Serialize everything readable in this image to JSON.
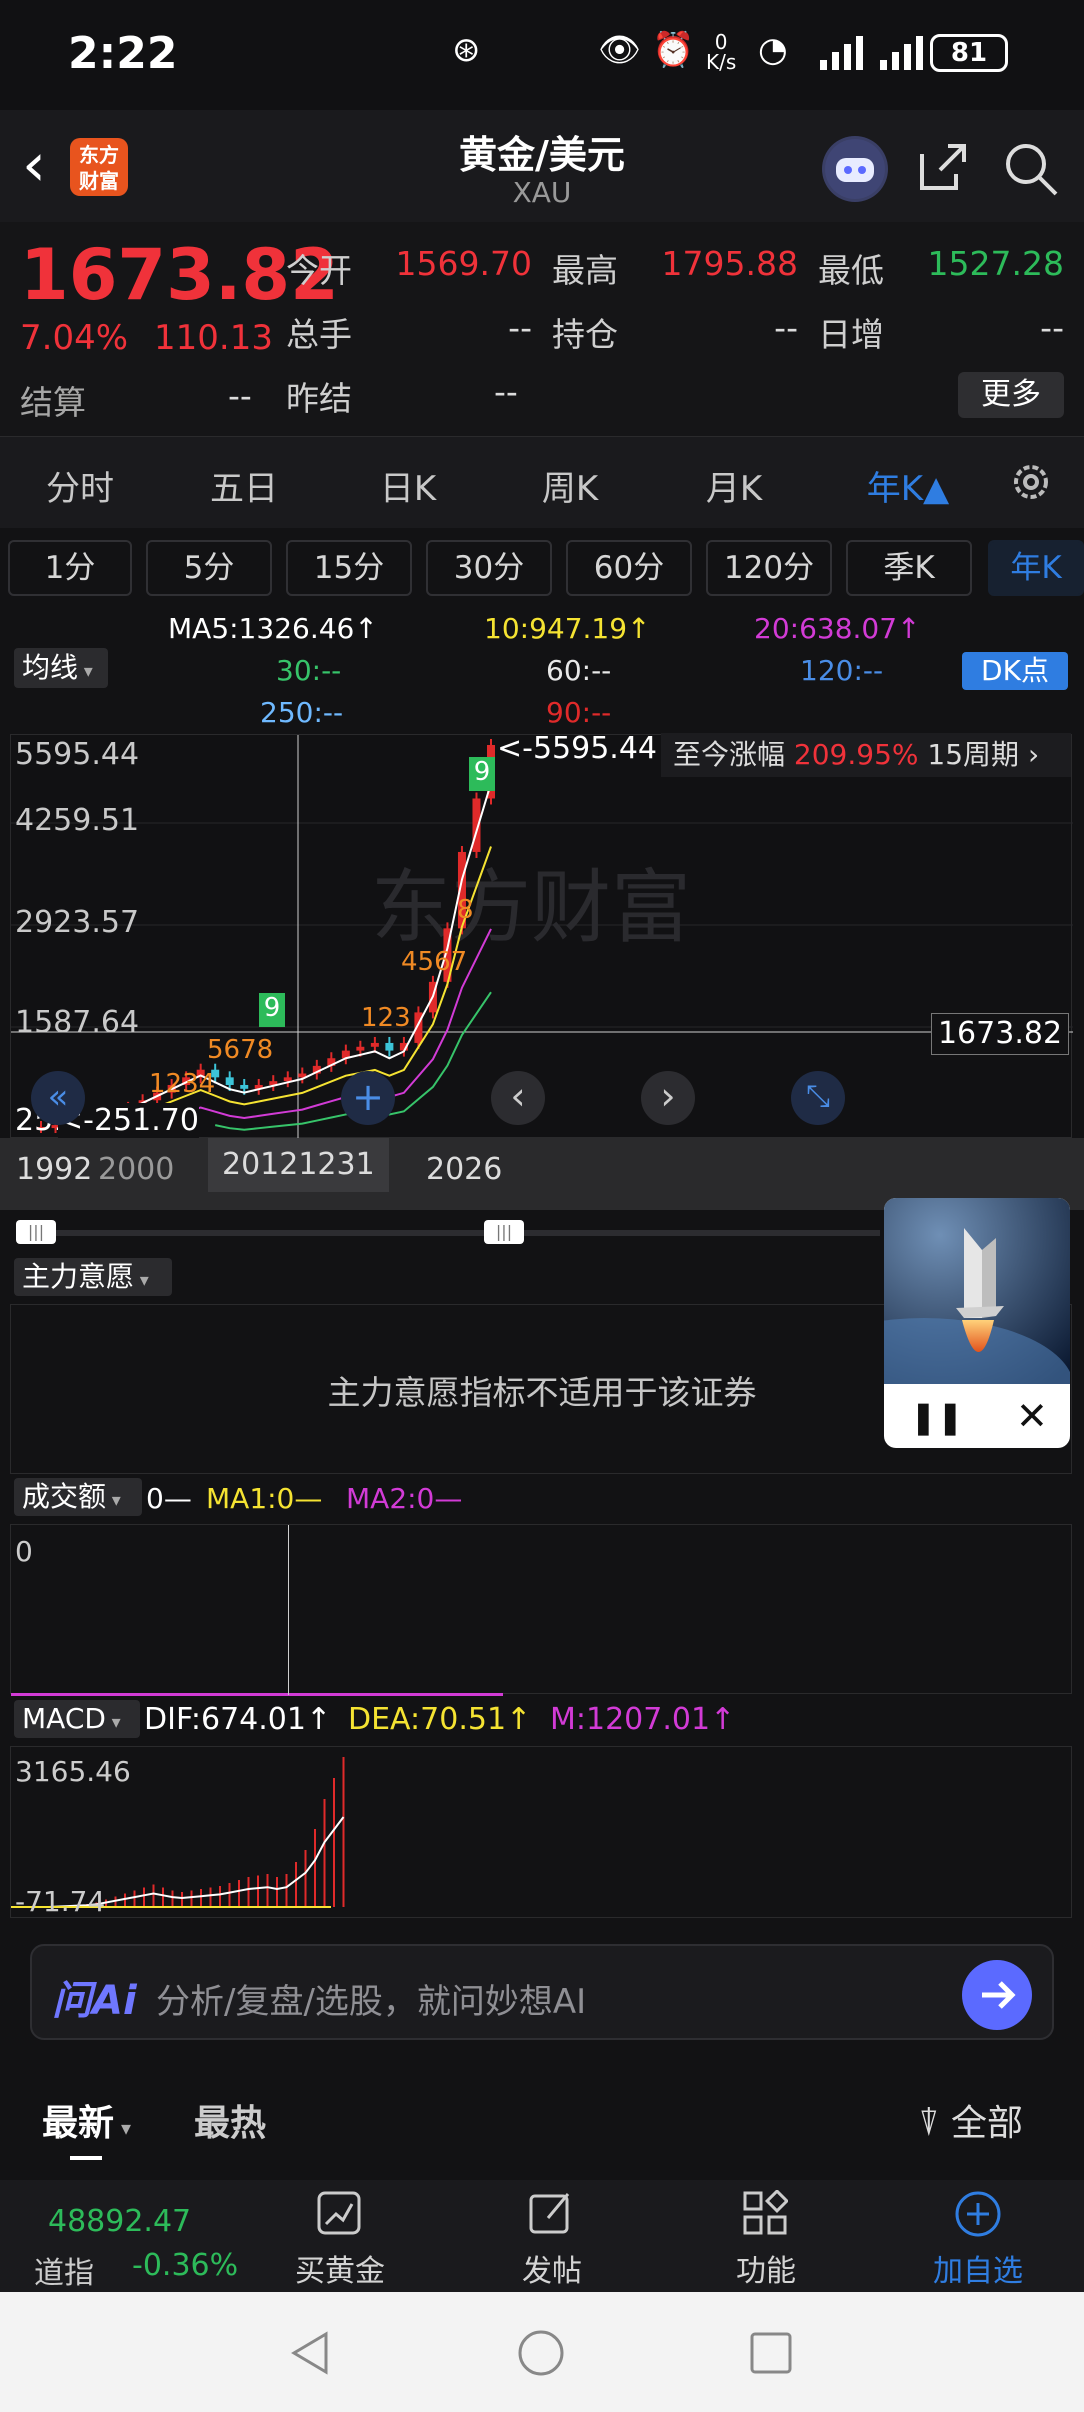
{
  "status": {
    "time": "2:22",
    "net": "0",
    "net_unit": "K/s",
    "battery": "81"
  },
  "header": {
    "title": "黄金/美元",
    "subtitle": "XAU",
    "logo": "东方财富"
  },
  "quote": {
    "price": "1673.82",
    "pct": "7.04%",
    "chg": "110.13",
    "open_l": "今开",
    "open_v": "1569.70",
    "high_l": "最高",
    "high_v": "1795.88",
    "low_l": "最低",
    "low_v": "1527.28",
    "vol_l": "总手",
    "vol_v": "--",
    "oi_l": "持仓",
    "oi_v": "--",
    "inc_l": "日增",
    "inc_v": "--",
    "settle_l": "结算",
    "settle_v": "--",
    "pset_l": "昨结",
    "pset_v": "--",
    "more": "更多"
  },
  "tabs": [
    "分时",
    "五日",
    "日K",
    "周K",
    "月K",
    "年K▲"
  ],
  "periods": [
    "1分",
    "5分",
    "15分",
    "30分",
    "60分",
    "120分",
    "季K",
    "年K"
  ],
  "ma": {
    "type": "均线",
    "ma5": "MA5:1326.46↑",
    "ma10": "10:947.19↑",
    "ma20": "20:638.07↑",
    "ma30": "30:--",
    "ma60": "60:--",
    "ma120": "120:--",
    "ma250": "250:--",
    "ma90": "90:--",
    "dk": "DK点"
  },
  "chart": {
    "y": [
      "5595.44",
      "4259.51",
      "2923.57",
      "1587.64",
      "251.70"
    ],
    "max_mark": "<-5595.44",
    "min_mark": "<-251.70",
    "cur_tag": "1673.82",
    "since_label": "至今涨幅",
    "since_val": "209.95%",
    "since_period": "15周期",
    "watermark": "东方财富",
    "x": [
      "1992",
      "2000",
      "20121231",
      "2026"
    ],
    "td": {
      "g9a": "9",
      "seq1": "1234",
      "seq2": "5678",
      "g9b": "9",
      "seq3": "123",
      "seq4": "4567",
      "s8": "8",
      "g9c": "9"
    }
  },
  "chart_data": {
    "type": "candlestick",
    "x_range": [
      "1992",
      "2026"
    ],
    "ylim": [
      251.7,
      5595.44
    ],
    "last": 1673.82,
    "high": 5595.44,
    "low": 251.7
  },
  "zz": {
    "label": "主力意愿",
    "note": "主力意愿指标不适用于该证券"
  },
  "volume": {
    "label": "成交额",
    "v": "0—",
    "ma1": "MA1:0—",
    "ma2": "MA2:0—",
    "y0": "0"
  },
  "macd": {
    "label": "MACD",
    "dif": "DIF:674.01↑",
    "dea": "DEA:70.51↑",
    "m": "M:1207.01↑",
    "ytop": "3165.46",
    "ybot": "-71.74"
  },
  "ai": {
    "logo": "问Ai",
    "placeholder": "分析/复盘/选股，就问妙想AI"
  },
  "news": {
    "t1": "最新",
    "t2": "最热",
    "filter": "全部"
  },
  "nav": {
    "idx_val": "48892.47",
    "idx_name": "道指",
    "idx_pct": "-0.36%",
    "buy": "买黄金",
    "post": "发帖",
    "func": "功能",
    "add": "加自选"
  }
}
